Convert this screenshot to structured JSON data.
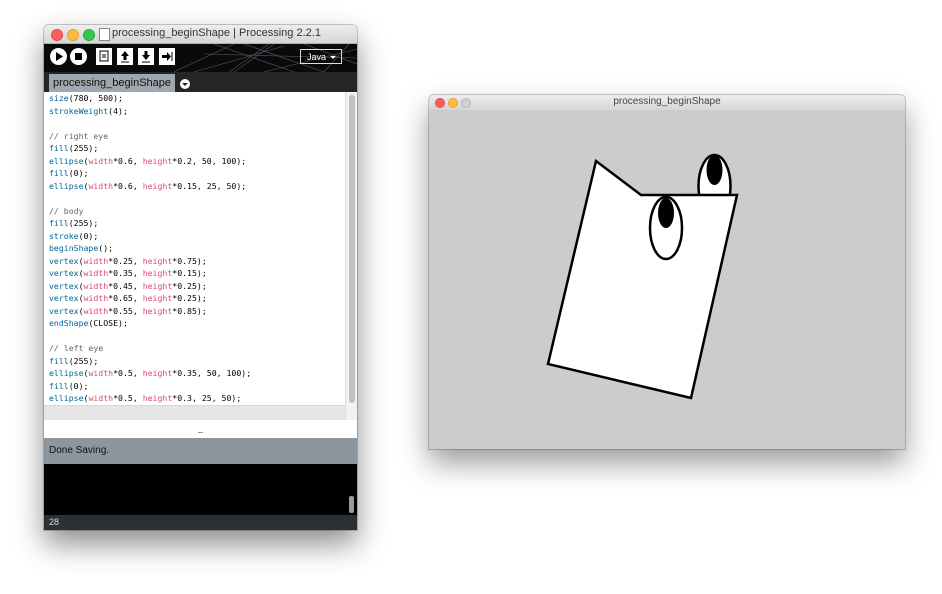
{
  "editor": {
    "window_title": "processing_beginShape | Processing 2.2.1",
    "mode_label": "Java",
    "tab_label": "processing_beginShape",
    "status_message": "Done Saving.",
    "line_number": "28",
    "code_lines": [
      [
        [
          "fn",
          "size"
        ],
        [
          "",
          "(780, 500);"
        ]
      ],
      [
        [
          "fn",
          "strokeWeight"
        ],
        [
          "",
          "(4);"
        ]
      ],
      [],
      [
        [
          "cm",
          "// right eye"
        ]
      ],
      [
        [
          "fn",
          "fill"
        ],
        [
          "",
          "(255);"
        ]
      ],
      [
        [
          "fn",
          "ellipse"
        ],
        [
          "",
          "("
        ],
        [
          "kw",
          "width"
        ],
        [
          "",
          "*0.6, "
        ],
        [
          "kw",
          "height"
        ],
        [
          "",
          "*0.2, 50, 100);"
        ]
      ],
      [
        [
          "fn",
          "fill"
        ],
        [
          "",
          "(0);"
        ]
      ],
      [
        [
          "fn",
          "ellipse"
        ],
        [
          "",
          "("
        ],
        [
          "kw",
          "width"
        ],
        [
          "",
          "*0.6, "
        ],
        [
          "kw",
          "height"
        ],
        [
          "",
          "*0.15, 25, 50);"
        ]
      ],
      [],
      [
        [
          "cm",
          "// body"
        ]
      ],
      [
        [
          "fn",
          "fill"
        ],
        [
          "",
          "(255);"
        ]
      ],
      [
        [
          "fn",
          "stroke"
        ],
        [
          "",
          "(0);"
        ]
      ],
      [
        [
          "fn",
          "beginShape"
        ],
        [
          "",
          "();"
        ]
      ],
      [
        [
          "fn",
          "vertex"
        ],
        [
          "",
          "("
        ],
        [
          "kw",
          "width"
        ],
        [
          "",
          "*0.25, "
        ],
        [
          "kw",
          "height"
        ],
        [
          "",
          "*0.75);"
        ]
      ],
      [
        [
          "fn",
          "vertex"
        ],
        [
          "",
          "("
        ],
        [
          "kw",
          "width"
        ],
        [
          "",
          "*0.35, "
        ],
        [
          "kw",
          "height"
        ],
        [
          "",
          "*0.15);"
        ]
      ],
      [
        [
          "fn",
          "vertex"
        ],
        [
          "",
          "("
        ],
        [
          "kw",
          "width"
        ],
        [
          "",
          "*0.45, "
        ],
        [
          "kw",
          "height"
        ],
        [
          "",
          "*0.25);"
        ]
      ],
      [
        [
          "fn",
          "vertex"
        ],
        [
          "",
          "("
        ],
        [
          "kw",
          "width"
        ],
        [
          "",
          "*0.65, "
        ],
        [
          "kw",
          "height"
        ],
        [
          "",
          "*0.25);"
        ]
      ],
      [
        [
          "fn",
          "vertex"
        ],
        [
          "",
          "("
        ],
        [
          "kw",
          "width"
        ],
        [
          "",
          "*0.55, "
        ],
        [
          "kw",
          "height"
        ],
        [
          "",
          "*0.85);"
        ]
      ],
      [
        [
          "fn",
          "endShape"
        ],
        [
          "",
          "(CLOSE);"
        ]
      ],
      [],
      [
        [
          "cm",
          "// left eye"
        ]
      ],
      [
        [
          "fn",
          "fill"
        ],
        [
          "",
          "(255);"
        ]
      ],
      [
        [
          "fn",
          "ellipse"
        ],
        [
          "",
          "("
        ],
        [
          "kw",
          "width"
        ],
        [
          "",
          "*0.5, "
        ],
        [
          "kw",
          "height"
        ],
        [
          "",
          "*0.35, 50, 100);"
        ]
      ],
      [
        [
          "fn",
          "fill"
        ],
        [
          "",
          "(0);"
        ]
      ],
      [
        [
          "fn",
          "ellipse"
        ],
        [
          "",
          "("
        ],
        [
          "kw",
          "width"
        ],
        [
          "",
          "*0.5, "
        ],
        [
          "kw",
          "height"
        ],
        [
          "",
          "*0.3, 25, 50);"
        ]
      ]
    ],
    "toolbar_buttons": [
      "run-icon",
      "stop-icon",
      "new-icon",
      "open-icon",
      "save-icon",
      "export-icon"
    ]
  },
  "sketch": {
    "window_title": "processing_beginShape",
    "background_color": "#cccccc",
    "stroke_color": "#000000"
  },
  "colors": {
    "function": "#006699",
    "keyword": "#d94a7a",
    "comment": "#666666",
    "status_bar": "#8b969f"
  }
}
